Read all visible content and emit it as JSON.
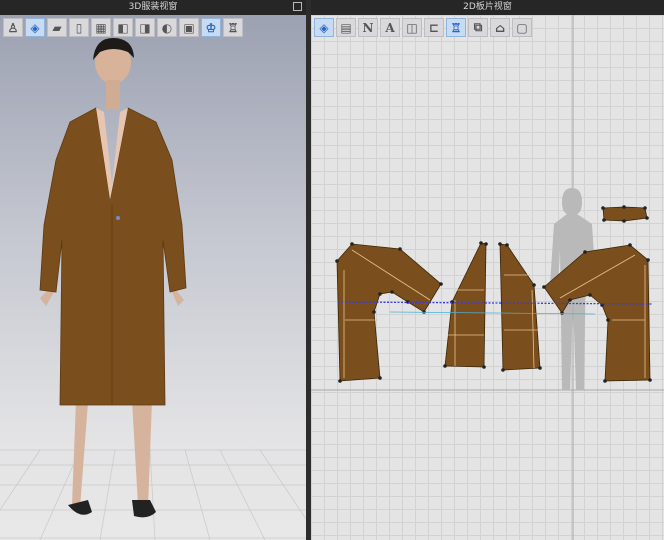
{
  "view3d": {
    "title": "3D服装视窗",
    "tools": [
      {
        "icon": "avatar-toggle-icon",
        "glyph": "♙"
      },
      {
        "icon": "show-garment-icon",
        "glyph": "◈",
        "active": true
      },
      {
        "icon": "texture-icon",
        "glyph": "▰"
      },
      {
        "icon": "transparent-icon",
        "glyph": "▯"
      },
      {
        "icon": "mesh-icon",
        "glyph": "▦"
      },
      {
        "icon": "shaded-icon",
        "glyph": "◧"
      },
      {
        "icon": "thickness-icon",
        "glyph": "◨"
      },
      {
        "icon": "render-icon",
        "glyph": "◐"
      },
      {
        "icon": "fit-map-icon",
        "glyph": "▣"
      },
      {
        "icon": "avatar-garment-icon",
        "glyph": "♔",
        "active": true
      },
      {
        "icon": "arrangement-icon",
        "glyph": "♖"
      }
    ]
  },
  "view2d": {
    "title": "2D板片视窗",
    "tools": [
      {
        "icon": "show-pattern-icon",
        "glyph": "◈",
        "active": true
      },
      {
        "icon": "pattern-texture-icon",
        "glyph": "▤"
      },
      {
        "icon": "pattern-name-icon",
        "glyph": "N"
      },
      {
        "icon": "annotation-icon",
        "glyph": "A"
      },
      {
        "icon": "baseline-icon",
        "glyph": "◫"
      },
      {
        "icon": "ruler-icon",
        "glyph": "⊏"
      },
      {
        "icon": "shirt-icon",
        "glyph": "♖",
        "active": true
      },
      {
        "icon": "piece-icon",
        "glyph": "⧉"
      },
      {
        "icon": "grade-icon",
        "glyph": "⌂"
      },
      {
        "icon": "frame-icon",
        "glyph": "▢"
      }
    ]
  },
  "colors": {
    "fabric": "#7a4e1d",
    "seam": "#e9c48a",
    "point": "#8faec8",
    "sync_line": "#3b3bd9"
  }
}
